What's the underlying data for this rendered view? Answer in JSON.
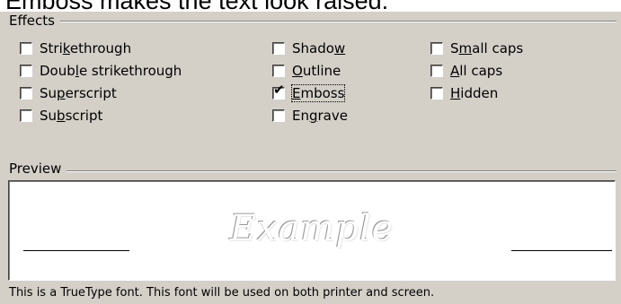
{
  "caption": "Emboss makes the text look raised.",
  "effects": {
    "title": "Effects",
    "options": [
      {
        "pre": "Stri",
        "key": "k",
        "post": "ethrough",
        "checked": false
      },
      {
        "pre": "Doub",
        "key": "l",
        "post": "e strikethrough",
        "checked": false
      },
      {
        "pre": "Su",
        "key": "p",
        "post": "erscript",
        "checked": false
      },
      {
        "pre": "Su",
        "key": "b",
        "post": "script",
        "checked": false
      },
      {
        "pre": "Shado",
        "key": "w",
        "post": "",
        "checked": false
      },
      {
        "pre": "",
        "key": "O",
        "post": "utline",
        "checked": false
      },
      {
        "pre": "",
        "key": "E",
        "post": "mboss",
        "checked": true
      },
      {
        "pre": "En",
        "key": "g",
        "post": "rave",
        "checked": false
      },
      {
        "pre": "S",
        "key": "m",
        "post": "all caps",
        "checked": false
      },
      {
        "pre": "",
        "key": "A",
        "post": "ll caps",
        "checked": false
      },
      {
        "pre": "",
        "key": "H",
        "post": "idden",
        "checked": false
      }
    ]
  },
  "preview": {
    "title": "Preview",
    "sample_text": "Example"
  },
  "status": "This is a TrueType font. This font will be used on both printer and screen.",
  "colors": {
    "dialog_bg": "#d4d0c8",
    "shadow": "#808080",
    "highlight": "#ffffff"
  }
}
